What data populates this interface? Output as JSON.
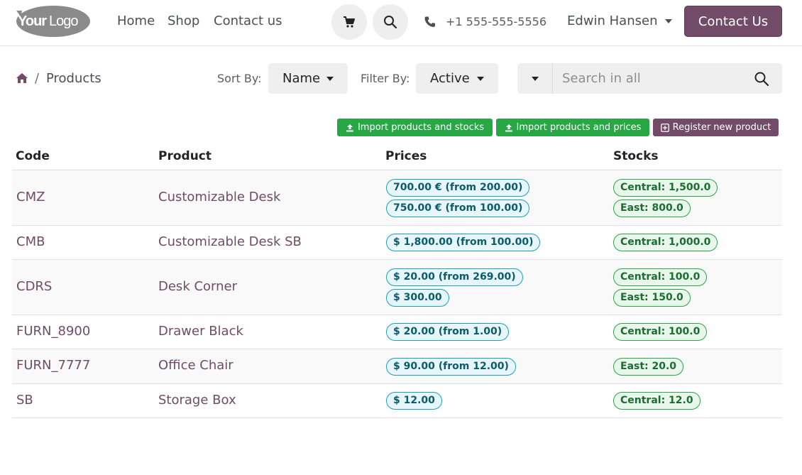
{
  "header": {
    "logo_text": "YourLogo",
    "nav": [
      "Home",
      "Shop",
      "Contact us"
    ],
    "cart_icon": "cart-icon",
    "search_icon": "search-icon",
    "phone": "+1 555-555-5556",
    "user": "Edwin Hansen",
    "contact_button": "Contact Us"
  },
  "breadcrumb": {
    "separator": "/",
    "current": "Products"
  },
  "toolbar": {
    "sort_label": "Sort By:",
    "sort_value": "Name",
    "filter_label": "Filter By:",
    "filter_value": "Active",
    "search_placeholder": "Search in all"
  },
  "actions": {
    "import_stocks": "Import products and stocks",
    "import_prices": "Import products and prices",
    "register": "Register new product"
  },
  "table": {
    "headers": {
      "code": "Code",
      "product": "Product",
      "prices": "Prices",
      "stocks": "Stocks"
    },
    "rows": [
      {
        "code": "CMZ",
        "product": "Customizable Desk",
        "prices": [
          "700.00 € (from 200.00)",
          "750.00 € (from 100.00)"
        ],
        "stocks": [
          "Central: 1,500.0",
          "East: 800.0"
        ]
      },
      {
        "code": "CMB",
        "product": "Customizable Desk SB",
        "prices": [
          "$ 1,800.00 (from 100.00)"
        ],
        "stocks": [
          "Central: 1,000.0"
        ]
      },
      {
        "code": "CDRS",
        "product": "Desk Corner",
        "prices": [
          "$ 20.00 (from 269.00)",
          "$ 300.00"
        ],
        "stocks": [
          "Central: 100.0",
          "East: 150.0"
        ]
      },
      {
        "code": "FURN_8900",
        "product": "Drawer Black",
        "prices": [
          "$ 20.00 (from 1.00)"
        ],
        "stocks": [
          "Central: 100.0"
        ]
      },
      {
        "code": "FURN_7777",
        "product": "Office Chair",
        "prices": [
          "$ 90.00 (from 12.00)"
        ],
        "stocks": [
          "East: 20.0"
        ]
      },
      {
        "code": "SB",
        "product": "Storage Box",
        "prices": [
          "$ 12.00"
        ],
        "stocks": [
          "Central: 12.0"
        ]
      }
    ]
  },
  "colors": {
    "brand": "#714b67",
    "success": "#28a745",
    "info": "#17a2b8"
  }
}
